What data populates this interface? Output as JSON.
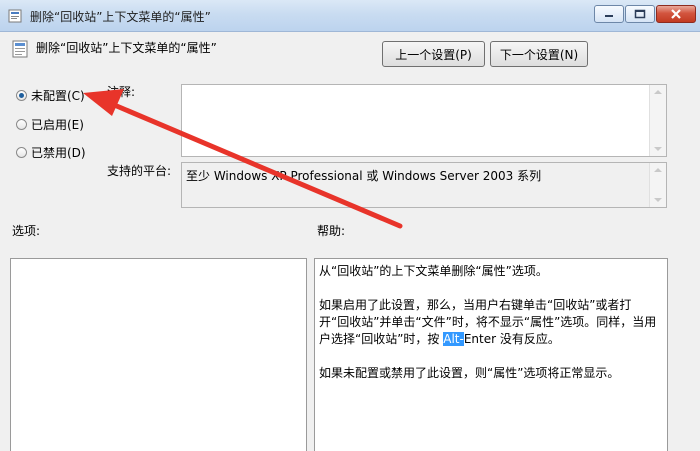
{
  "window": {
    "title": "删除“回收站”上下文菜单的“属性”"
  },
  "header": {
    "title": "删除“回收站”上下文菜单的“属性”",
    "prev_button": "上一个设置(P)",
    "next_button": "下一个设置(N)"
  },
  "radios": [
    {
      "label": "未配置(C)",
      "checked": true
    },
    {
      "label": "已启用(E)",
      "checked": false
    },
    {
      "label": "已禁用(D)",
      "checked": false
    }
  ],
  "comment": {
    "label": "注释:",
    "value": ""
  },
  "platform": {
    "label": "支持的平台:",
    "value": "至少 Windows XP Professional 或 Windows Server 2003 系列"
  },
  "options": {
    "label": "选项:"
  },
  "help": {
    "label": "帮助:",
    "para1": "从“回收站”的上下文菜单删除“属性”选项。",
    "para2_a": "如果启用了此设置，那么，当用户右键单击“回收站”或者打开“回收站”并单击“文件”时，将不显示“属性”选项。同样，当用户选择“回收站”时，按 ",
    "para2_sel": "Alt-",
    "para2_b": "Enter 没有反应。",
    "para3": "如果未配置或禁用了此设置，则“属性”选项将正常显示。"
  },
  "colors": {
    "annotation_arrow": "#e8342a",
    "selection": "#3399ff"
  }
}
